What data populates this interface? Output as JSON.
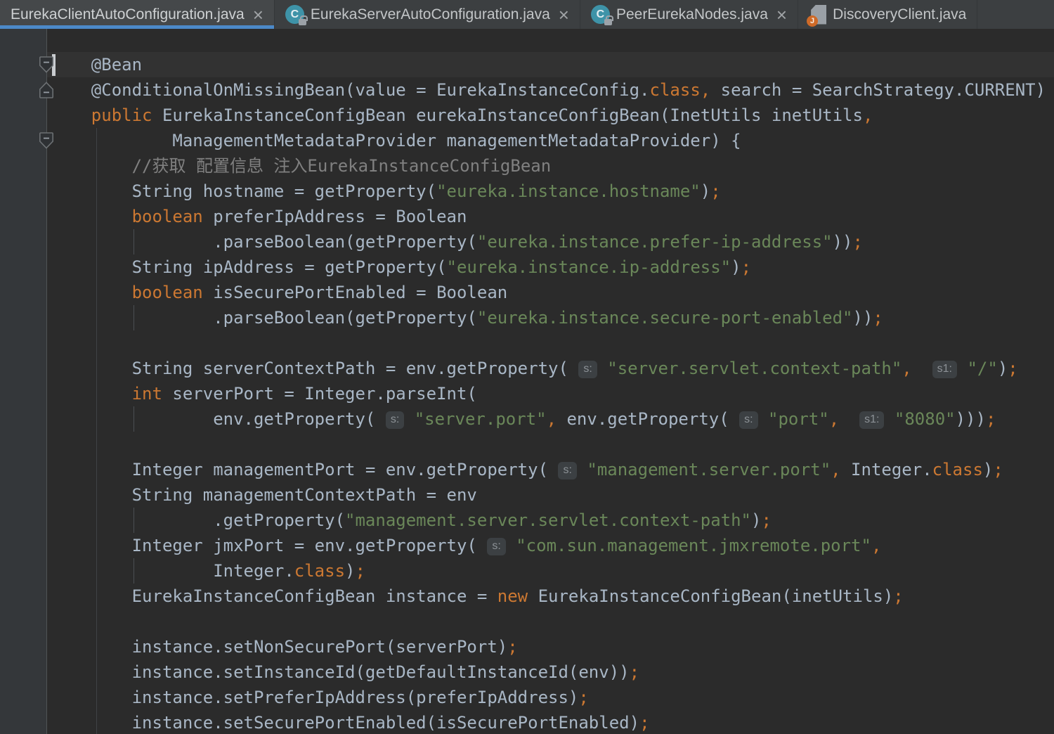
{
  "window": {
    "app": "intellij-idea-editor"
  },
  "colors": {
    "editor_bg": "#2B2B2B",
    "gutter_bg": "#34373A",
    "gutter_separator": "#4F5355",
    "tabbar_bg": "#3C3F41",
    "active_tab_bg": "#45484A",
    "active_tab_underline": "#4C89C8",
    "tab_text": "#C3C6C8",
    "caret_row_bg": "#323232",
    "default_text": "#A9B7C6",
    "keyword": "#CC7832",
    "string": "#6A8759",
    "comment": "#808080",
    "punctuation": "#CC7832",
    "inlay_hint_bg": "#3C4043",
    "inlay_hint_text": "#8C9196",
    "class_icon": "#3E93A8",
    "java_ball_icon": "#CE6A28"
  },
  "tabbar": {
    "tabs": [
      {
        "label": "EurekaClientAutoConfiguration.java",
        "icon": null,
        "active": true,
        "closable": true
      },
      {
        "label": "EurekaServerAutoConfiguration.java",
        "icon": "class-locked",
        "active": false,
        "closable": true
      },
      {
        "label": "PeerEurekaNodes.java",
        "icon": "class-locked",
        "active": false,
        "closable": true
      },
      {
        "label": "DiscoveryClient.java",
        "icon": "java-file",
        "active": false,
        "closable": false
      }
    ],
    "close_glyph": "×",
    "class_icon_letter": "C",
    "java_icon_letter": "J"
  },
  "editor": {
    "caret_line": 1,
    "fold_markers": [
      {
        "line": 1,
        "dir": "down"
      },
      {
        "line": 2,
        "dir": "up"
      },
      {
        "line": 4,
        "dir": "down"
      }
    ],
    "token_legend": {
      "t": "default",
      "k": "keyword",
      "s": "string",
      "c": "comment",
      "p": "punctuation",
      "h": "inlay-hint"
    },
    "lines": [
      {
        "cur": 1,
        "tokens": [
          [
            "t",
            "    @Bean"
          ]
        ]
      },
      {
        "tokens": [
          [
            "t",
            "    @ConditionalOnMissingBean(value = EurekaInstanceConfig."
          ],
          [
            "k",
            "class"
          ],
          [
            "p",
            ","
          ],
          [
            "t",
            " search = SearchStrategy.CURRENT)"
          ]
        ]
      },
      {
        "tokens": [
          [
            "t",
            "    "
          ],
          [
            "k",
            "public"
          ],
          [
            "t",
            " EurekaInstanceConfigBean eurekaInstanceConfigBean(InetUtils inetUtils"
          ],
          [
            "p",
            ","
          ]
        ]
      },
      {
        "g4": 1,
        "tokens": [
          [
            "t",
            "            ManagementMetadataProvider managementMetadataProvider) {"
          ]
        ]
      },
      {
        "g4": 1,
        "tokens": [
          [
            "t",
            "        "
          ],
          [
            "c",
            "//获取 配置信息 注入EurekaInstanceConfigBean"
          ]
        ]
      },
      {
        "g4": 1,
        "tokens": [
          [
            "t",
            "        String hostname = getProperty("
          ],
          [
            "s",
            "\"eureka.instance.hostname\""
          ],
          [
            "t",
            ")"
          ],
          [
            "p",
            ";"
          ]
        ]
      },
      {
        "g4": 1,
        "tokens": [
          [
            "t",
            "        "
          ],
          [
            "k",
            "boolean"
          ],
          [
            "t",
            " preferIpAddress = Boolean"
          ]
        ]
      },
      {
        "g4": 1,
        "g8": 1,
        "tokens": [
          [
            "t",
            "                .parseBoolean(getProperty("
          ],
          [
            "s",
            "\"eureka.instance.prefer-ip-address\""
          ],
          [
            "t",
            "))"
          ],
          [
            "p",
            ";"
          ]
        ]
      },
      {
        "g4": 1,
        "tokens": [
          [
            "t",
            "        String ipAddress = getProperty("
          ],
          [
            "s",
            "\"eureka.instance.ip-address\""
          ],
          [
            "t",
            ")"
          ],
          [
            "p",
            ";"
          ]
        ]
      },
      {
        "g4": 1,
        "tokens": [
          [
            "t",
            "        "
          ],
          [
            "k",
            "boolean"
          ],
          [
            "t",
            " isSecurePortEnabled = Boolean"
          ]
        ]
      },
      {
        "g4": 1,
        "g8": 1,
        "tokens": [
          [
            "t",
            "                .parseBoolean(getProperty("
          ],
          [
            "s",
            "\"eureka.instance.secure-port-enabled\""
          ],
          [
            "t",
            "))"
          ],
          [
            "p",
            ";"
          ]
        ]
      },
      {
        "g4": 1,
        "tokens": []
      },
      {
        "g4": 1,
        "tokens": [
          [
            "t",
            "        String serverContextPath = env.getProperty( "
          ],
          [
            "h",
            "s:"
          ],
          [
            "t",
            " "
          ],
          [
            "s",
            "\"server.servlet.context-path\""
          ],
          [
            "p",
            ","
          ],
          [
            "t",
            "  "
          ],
          [
            "h",
            "s1:"
          ],
          [
            "t",
            " "
          ],
          [
            "s",
            "\"/\""
          ],
          [
            "t",
            ")"
          ],
          [
            "p",
            ";"
          ]
        ]
      },
      {
        "g4": 1,
        "tokens": [
          [
            "t",
            "        "
          ],
          [
            "k",
            "int"
          ],
          [
            "t",
            " serverPort = Integer.parseInt("
          ]
        ]
      },
      {
        "g4": 1,
        "g8": 1,
        "tokens": [
          [
            "t",
            "                env.getProperty( "
          ],
          [
            "h",
            "s:"
          ],
          [
            "t",
            " "
          ],
          [
            "s",
            "\"server.port\""
          ],
          [
            "p",
            ","
          ],
          [
            "t",
            " env.getProperty( "
          ],
          [
            "h",
            "s:"
          ],
          [
            "t",
            " "
          ],
          [
            "s",
            "\"port\""
          ],
          [
            "p",
            ","
          ],
          [
            "t",
            "  "
          ],
          [
            "h",
            "s1:"
          ],
          [
            "t",
            " "
          ],
          [
            "s",
            "\"8080\""
          ],
          [
            "t",
            ")))"
          ],
          [
            "p",
            ";"
          ]
        ]
      },
      {
        "g4": 1,
        "tokens": []
      },
      {
        "g4": 1,
        "tokens": [
          [
            "t",
            "        Integer managementPort = env.getProperty( "
          ],
          [
            "h",
            "s:"
          ],
          [
            "t",
            " "
          ],
          [
            "s",
            "\"management.server.port\""
          ],
          [
            "p",
            ","
          ],
          [
            "t",
            " Integer."
          ],
          [
            "k",
            "class"
          ],
          [
            "t",
            ")"
          ],
          [
            "p",
            ";"
          ]
        ]
      },
      {
        "g4": 1,
        "tokens": [
          [
            "t",
            "        String managementContextPath = env"
          ]
        ]
      },
      {
        "g4": 1,
        "g8": 1,
        "tokens": [
          [
            "t",
            "                .getProperty("
          ],
          [
            "s",
            "\"management.server.servlet.context-path\""
          ],
          [
            "t",
            ")"
          ],
          [
            "p",
            ";"
          ]
        ]
      },
      {
        "g4": 1,
        "tokens": [
          [
            "t",
            "        Integer jmxPort = env.getProperty( "
          ],
          [
            "h",
            "s:"
          ],
          [
            "t",
            " "
          ],
          [
            "s",
            "\"com.sun.management.jmxremote.port\""
          ],
          [
            "p",
            ","
          ]
        ]
      },
      {
        "g4": 1,
        "g8": 1,
        "tokens": [
          [
            "t",
            "                Integer."
          ],
          [
            "k",
            "class"
          ],
          [
            "t",
            ")"
          ],
          [
            "p",
            ";"
          ]
        ]
      },
      {
        "g4": 1,
        "tokens": [
          [
            "t",
            "        EurekaInstanceConfigBean instance = "
          ],
          [
            "k",
            "new"
          ],
          [
            "t",
            " EurekaInstanceConfigBean(inetUtils)"
          ],
          [
            "p",
            ";"
          ]
        ]
      },
      {
        "g4": 1,
        "tokens": []
      },
      {
        "g4": 1,
        "tokens": [
          [
            "t",
            "        instance.setNonSecurePort(serverPort)"
          ],
          [
            "p",
            ";"
          ]
        ]
      },
      {
        "g4": 1,
        "tokens": [
          [
            "t",
            "        instance.setInstanceId(getDefaultInstanceId(env))"
          ],
          [
            "p",
            ";"
          ]
        ]
      },
      {
        "g4": 1,
        "tokens": [
          [
            "t",
            "        instance.setPreferIpAddress(preferIpAddress)"
          ],
          [
            "p",
            ";"
          ]
        ]
      },
      {
        "g4": 1,
        "tokens": [
          [
            "t",
            "        instance.setSecurePortEnabled(isSecurePortEnabled)"
          ],
          [
            "p",
            ";"
          ]
        ]
      }
    ]
  }
}
